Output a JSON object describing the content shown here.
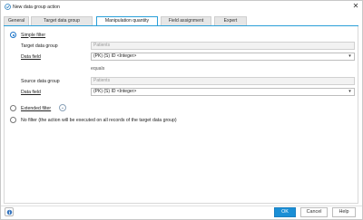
{
  "window": {
    "title": "New data group action",
    "close_glyph": "✕"
  },
  "tabs": [
    {
      "label": "General"
    },
    {
      "label": "Target data group"
    },
    {
      "label": "Manipulation quantity"
    },
    {
      "label": "Field assignment"
    },
    {
      "label": "Expert"
    }
  ],
  "active_tab": "Manipulation quantity",
  "filter": {
    "simple_label": "Simple filter",
    "simple_checked": true,
    "target_group_label": "Target data group",
    "target_group_value": "Patients",
    "target_field_label": "Data field",
    "target_field_value": "(PK) (S) ID <Integer>",
    "equals_label": "equals",
    "source_group_label": "Source data group",
    "source_group_value": "Patients",
    "source_field_label": "Data field",
    "source_field_value": "(PK) (S) ID <Integer>",
    "extended_label": "Extended filter",
    "extended_checked": false,
    "no_filter_label": "No filter (the action will be executed on all records of the target data group)",
    "no_filter_checked": false
  },
  "footer": {
    "ok_label": "OK",
    "cancel_label": "Cancel",
    "help_label": "Help"
  },
  "colors": {
    "accent": "#1a8fd6",
    "tab_active_border": "#2a9fd8"
  },
  "icons": {
    "app": "data-group-action-icon",
    "dropdown": "chevron-down-icon",
    "expand": "chevron-down-circle-icon",
    "bottom": "help-info-icon"
  }
}
